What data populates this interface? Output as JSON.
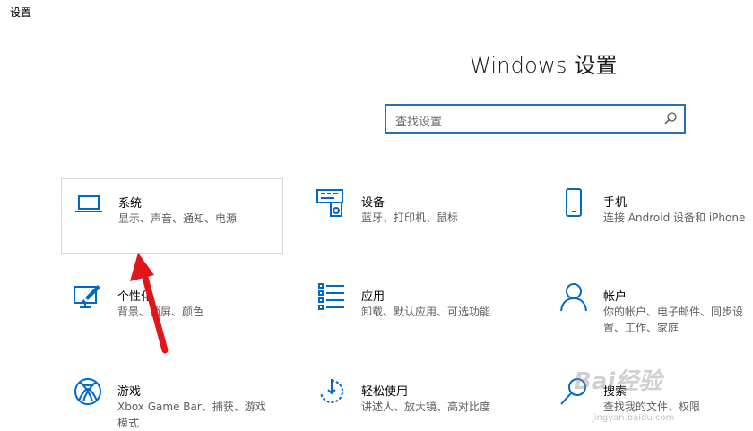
{
  "window": {
    "title": "设置"
  },
  "heading": "Windows 设置",
  "search": {
    "placeholder": "查找设置"
  },
  "tiles": [
    {
      "title": "系统",
      "desc": "显示、声音、通知、电源",
      "icon": "laptop-icon"
    },
    {
      "title": "设备",
      "desc": "蓝牙、打印机、鼠标",
      "icon": "devices-icon"
    },
    {
      "title": "手机",
      "desc": "连接 Android 设备和 iPhone",
      "icon": "phone-icon"
    },
    {
      "title": "个性化",
      "desc": "背景、锁屏、颜色",
      "icon": "personalization-icon"
    },
    {
      "title": "应用",
      "desc": "卸载、默认应用、可选功能",
      "icon": "apps-icon"
    },
    {
      "title": "帐户",
      "desc": "你的帐户、电子邮件、同步设置、工作、家庭",
      "icon": "account-icon"
    },
    {
      "title": "游戏",
      "desc": "Xbox Game Bar、捕获、游戏模式",
      "icon": "xbox-icon"
    },
    {
      "title": "轻松使用",
      "desc": "讲述人、放大镜、高对比度",
      "icon": "ease-of-access-icon"
    },
    {
      "title": "搜索",
      "desc": "查找我的文件、权限",
      "icon": "search-icon"
    }
  ],
  "colors": {
    "accent": "#0068c9",
    "annotation_arrow": "#e0161b"
  },
  "watermark": {
    "text": "Bai经验",
    "sub": "jingyan.baidu.com"
  }
}
